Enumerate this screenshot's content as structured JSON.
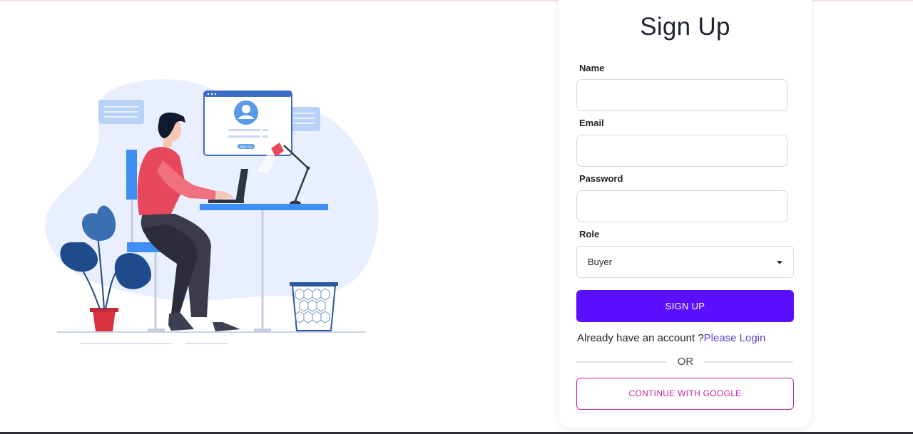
{
  "form": {
    "title": "Sign Up",
    "name_label": "Name",
    "name_value": "",
    "email_label": "Email",
    "email_value": "",
    "password_label": "Password",
    "password_value": "",
    "role_label": "Role",
    "role_selected": "Buyer",
    "signup_button": "SIGN UP",
    "already_text": "Already have an account ?",
    "login_link": "Please Login",
    "or_text": "OR",
    "google_button": "CONTINUE WITH GOOGLE"
  },
  "illustration": {
    "screen_button_text": "Sign Up"
  },
  "colors": {
    "primary": "#5a10ff",
    "google_accent": "#c21fa8",
    "link": "#5b3fd3"
  }
}
